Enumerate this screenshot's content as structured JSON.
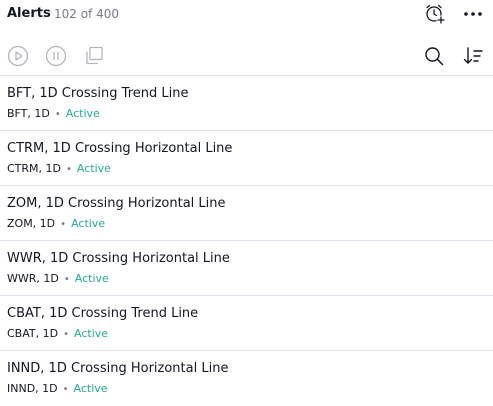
{
  "header": {
    "title": "Alerts",
    "count": "102 of 400",
    "icons": [
      "add-alarm-icon",
      "more-icon"
    ]
  },
  "toolbar": {
    "icons": [
      "play-icon",
      "pause-icon",
      "copy-icon",
      "search-icon",
      "sort-icon"
    ]
  },
  "colors": {
    "active": "#22ab94",
    "muted": "#787b86",
    "text": "#131722",
    "divider": "#e0e3eb"
  },
  "alerts": [
    {
      "title": "BFT, 1D Crossing Trend Line",
      "meta": "BFT, 1D",
      "status": "Active"
    },
    {
      "title": "CTRM, 1D Crossing Horizontal Line",
      "meta": "CTRM, 1D",
      "status": "Active"
    },
    {
      "title": "ZOM, 1D Crossing Horizontal Line",
      "meta": "ZOM, 1D",
      "status": "Active"
    },
    {
      "title": "WWR, 1D Crossing Horizontal Line",
      "meta": "WWR, 1D",
      "status": "Active"
    },
    {
      "title": "CBAT, 1D Crossing Trend Line",
      "meta": "CBAT, 1D",
      "status": "Active"
    },
    {
      "title": "INND, 1D Crossing Horizontal Line",
      "meta": "INND, 1D",
      "status": "Active"
    }
  ]
}
